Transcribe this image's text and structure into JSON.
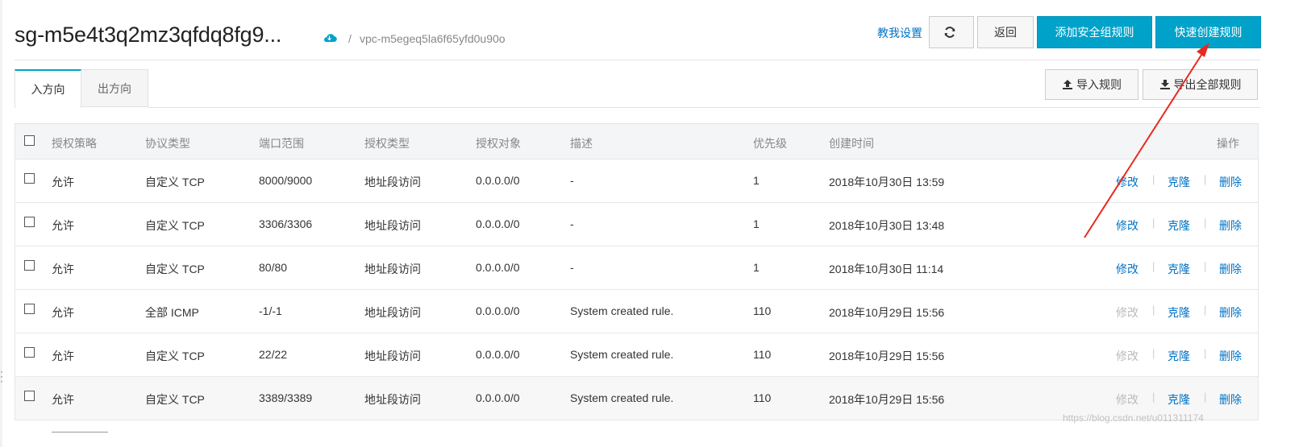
{
  "header": {
    "sg_title": "sg-m5e4t3q2mz3qfdq8fg9...",
    "vpc_separator": "/",
    "vpc_id": "vpc-m5egeq5la6f65yfd0u90o",
    "teach_link": "教我设置",
    "back_label": "返回",
    "add_rule_label": "添加安全组规则",
    "quick_create_label": "快速创建规则"
  },
  "tabs": [
    {
      "label": "入方向",
      "active": true
    },
    {
      "label": "出方向",
      "active": false
    }
  ],
  "toolbar": {
    "import_label": "导入规则",
    "export_label": "导出全部规则"
  },
  "table": {
    "columns": [
      "授权策略",
      "协议类型",
      "端口范围",
      "授权类型",
      "授权对象",
      "描述",
      "优先级",
      "创建时间",
      "操作"
    ],
    "rows": [
      {
        "policy": "允许",
        "protocol": "自定义 TCP",
        "port": "8000/9000",
        "auth_type": "地址段访问",
        "auth_object": "0.0.0.0/0",
        "description": "-",
        "priority": "1",
        "created": "2018年10月30日 13:59",
        "edit_enabled": true
      },
      {
        "policy": "允许",
        "protocol": "自定义 TCP",
        "port": "3306/3306",
        "auth_type": "地址段访问",
        "auth_object": "0.0.0.0/0",
        "description": "-",
        "priority": "1",
        "created": "2018年10月30日 13:48",
        "edit_enabled": true
      },
      {
        "policy": "允许",
        "protocol": "自定义 TCP",
        "port": "80/80",
        "auth_type": "地址段访问",
        "auth_object": "0.0.0.0/0",
        "description": "-",
        "priority": "1",
        "created": "2018年10月30日 11:14",
        "edit_enabled": true
      },
      {
        "policy": "允许",
        "protocol": "全部 ICMP",
        "port": "-1/-1",
        "auth_type": "地址段访问",
        "auth_object": "0.0.0.0/0",
        "description": "System created rule.",
        "priority": "110",
        "created": "2018年10月29日 15:56",
        "edit_enabled": false
      },
      {
        "policy": "允许",
        "protocol": "自定义 TCP",
        "port": "22/22",
        "auth_type": "地址段访问",
        "auth_object": "0.0.0.0/0",
        "description": "System created rule.",
        "priority": "110",
        "created": "2018年10月29日 15:56",
        "edit_enabled": false
      },
      {
        "policy": "允许",
        "protocol": "自定义 TCP",
        "port": "3389/3389",
        "auth_type": "地址段访问",
        "auth_object": "0.0.0.0/0",
        "description": "System created rule.",
        "priority": "110",
        "created": "2018年10月29日 15:56",
        "edit_enabled": false
      }
    ],
    "actions": {
      "edit": "修改",
      "clone": "克隆",
      "delete": "删除",
      "separator": "|"
    }
  },
  "watermark": "https://blog.csdn.net/u011311174",
  "colors": {
    "primary": "#00a2ca",
    "link": "#0073c6",
    "annotation_arrow": "#e8291c"
  },
  "icons": {
    "refresh": "refresh-icon",
    "cloud": "cloud-icon",
    "import": "upload-icon",
    "export": "download-icon"
  }
}
